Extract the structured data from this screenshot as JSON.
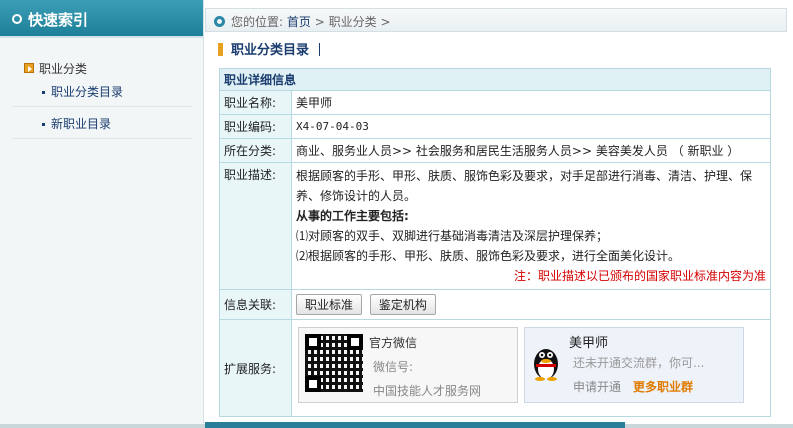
{
  "sidebar": {
    "title": "快速索引",
    "category": "职业分类",
    "links": [
      "职业分类目录",
      "新职业目录"
    ]
  },
  "breadcrumb": {
    "prefix": "您的位置:",
    "home": "首页",
    "separator": ">",
    "current": "职业分类"
  },
  "page_title": "职业分类目录",
  "detail": {
    "header": "职业详细信息",
    "rows": [
      {
        "key": "职业名称:",
        "value": "美甲师"
      },
      {
        "key": "职业编码:",
        "value": "X4-07-04-03"
      },
      {
        "key": "所在分类:",
        "value": "商业、服务业人员>> 社会服务和居民生活服务人员>> 美容美发人员 （ 新职业 ）"
      }
    ],
    "desc_key": "职业描述:",
    "desc_text": "根据顾客的手形、甲形、肤质、服饰色彩及要求，对手足部进行消毒、清洁、护理、保养、修饰设计的人员。",
    "desc_subtitle": "从事的工作主要包括:",
    "desc_items": [
      "⑴对顾客的双手、双脚进行基础消毒清洁及深层护理保养；",
      "⑵根据顾客的手形、甲形、肤质、服饰色彩及要求，进行全面美化设计。"
    ],
    "desc_note": "注：职业描述以已颁布的国家职业标准内容为准",
    "related_key": "信息关联:",
    "related_buttons": [
      "职业标准",
      "鉴定机构"
    ],
    "ext_key": "扩展服务:",
    "wechat": {
      "title": "官方微信",
      "id_label": "微信号:",
      "name": "中国技能人才服务网"
    },
    "qq": {
      "name": "美甲师",
      "status": "还未开通交流群，你可...",
      "apply": "申请开通",
      "more": "更多职业群"
    }
  },
  "colors": {
    "accent": "#2a87a6",
    "link": "#1a3c6e",
    "note": "#d40000",
    "more": "#e07b00"
  }
}
